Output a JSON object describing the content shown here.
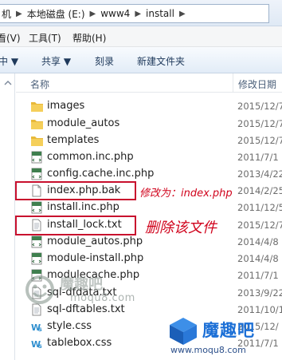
{
  "address": {
    "crumbs": [
      "机",
      "本地磁盘 (E:)",
      "www4",
      "install"
    ],
    "separator": "▶"
  },
  "menu": {
    "items": [
      "看(V)",
      "工具(T)",
      "帮助(H)"
    ]
  },
  "toolbar": {
    "organize": "中 ▼",
    "share": "共享 ▼",
    "burn": "刻录",
    "new_folder": "新建文件夹"
  },
  "columns": {
    "name": "名称",
    "date": "修改日期"
  },
  "files": [
    {
      "name": "images",
      "date": "2015/12/7",
      "icon": "folder-icon"
    },
    {
      "name": "module_autos",
      "date": "2015/12/7",
      "icon": "folder-icon"
    },
    {
      "name": "templates",
      "date": "2015/12/7",
      "icon": "folder-icon"
    },
    {
      "name": "common.inc.php",
      "date": "2011/7/1",
      "icon": "php-file-icon"
    },
    {
      "name": "config.cache.inc.php",
      "date": "2013/4/22",
      "icon": "php-file-icon"
    },
    {
      "name": "index.php.bak",
      "date": "2014/2/25",
      "icon": "blank-file-icon"
    },
    {
      "name": "install.inc.php",
      "date": "2011/12/5",
      "icon": "php-file-icon"
    },
    {
      "name": "install_lock.txt",
      "date": "2015/12/7",
      "icon": "text-file-icon"
    },
    {
      "name": "module_autos.php",
      "date": "2014/4/8",
      "icon": "php-file-icon"
    },
    {
      "name": "module-install.php",
      "date": "2014/4/8",
      "icon": "php-file-icon"
    },
    {
      "name": "modulecache.php",
      "date": "2011/7/1",
      "icon": "php-file-icon"
    },
    {
      "name": "sql-dfdata.txt",
      "date": "2013/9/22",
      "icon": "text-file-icon"
    },
    {
      "name": "sql-dftables.txt",
      "date": "2011/10/1",
      "icon": "text-file-icon"
    },
    {
      "name": "style.css",
      "date": "2015/12/",
      "icon": "css-file-icon"
    },
    {
      "name": "tablebox.css",
      "date": "2011/7/1",
      "icon": "css-file-icon"
    }
  ],
  "annotations": {
    "rename_note": "修改为：index.php",
    "delete_note": "删除该文件"
  },
  "watermarks": {
    "logo_text": "魔趣吧",
    "url_small": "moqu8.com",
    "brand_name": "魔趣吧",
    "brand_url": "www.moqu8.com"
  },
  "colors": {
    "callout_red": "#c8102e",
    "brand_blue": "#1b6fd6"
  }
}
